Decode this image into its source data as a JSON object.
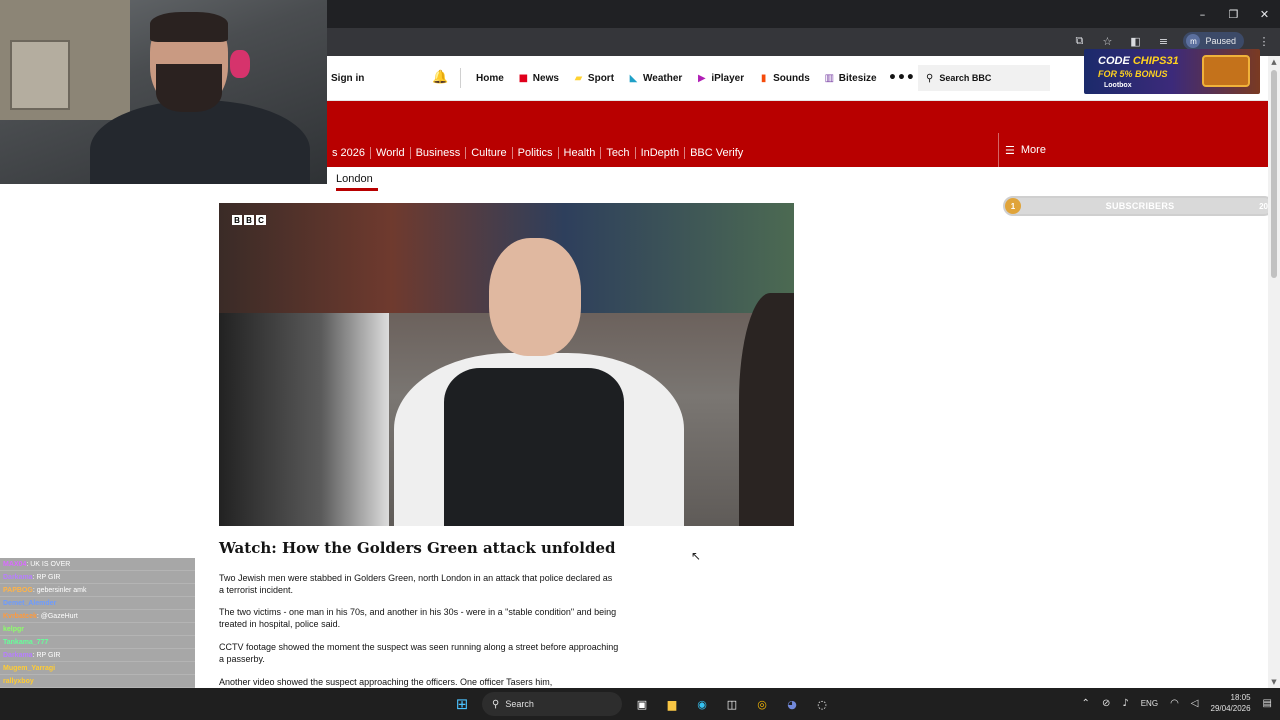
{
  "window": {
    "controls": [
      "–",
      "❐",
      "✕"
    ],
    "profile_initial": "m",
    "profile_status": "Paused"
  },
  "bbc": {
    "sign_in": "Sign in",
    "nav": [
      {
        "label": "Home",
        "icon": "",
        "color": "#141414"
      },
      {
        "label": "News",
        "icon": "news-icon",
        "color": "#e0001b"
      },
      {
        "label": "Sport",
        "icon": "sport-icon",
        "color": "#ffd230"
      },
      {
        "label": "Weather",
        "icon": "weather-icon",
        "color": "#1fa0c7"
      },
      {
        "label": "iPlayer",
        "icon": "iplayer-icon",
        "color": "#b01eb5"
      },
      {
        "label": "Sounds",
        "icon": "sounds-icon",
        "color": "#f54b0b"
      },
      {
        "label": "Bitesize",
        "icon": "bitesize-icon",
        "color": "#7941a5"
      }
    ],
    "search_placeholder": "Search BBC",
    "section_nav": [
      "s 2026",
      "World",
      "Business",
      "Culture",
      "Politics",
      "Health",
      "Tech",
      "InDepth",
      "BBC Verify"
    ],
    "more_label": "More",
    "subnav_active": "London",
    "brand_color": "#b80000"
  },
  "ad": {
    "line1_prefix": "CODE ",
    "line1_code": "CHIPS31",
    "line2": "FOR 5% BONUS",
    "brand": "Lootbox"
  },
  "hero": {
    "logo_letters": [
      "B",
      "B",
      "C"
    ]
  },
  "article": {
    "headline": "Watch: How the Golders Green attack unfolded",
    "paragraphs": [
      "Two Jewish men were stabbed in Golders Green, north London in an attack that police declared as a terrorist incident.",
      "The two victims - one man in his 70s, and another in his 30s - were in a \"stable condition\" and being treated in hospital, police said.",
      "CCTV footage showed the moment the suspect was seen running along a street before approaching a passerby.",
      "Another video showed the suspect approaching the officers. One officer Tasers him,"
    ]
  },
  "subscribers": {
    "current": "1",
    "label": "SUBSCRIBERS",
    "goal": "20",
    "progress": 0.05
  },
  "chat": [
    {
      "user": "MAX04",
      "msg": ": UK IS OVER",
      "color": "#d86bff"
    },
    {
      "user": "Darkama",
      "msg": ": RP GIR",
      "color": "#b77dff"
    },
    {
      "user": "PAPBOG",
      "msg": ": gebersinler amk",
      "color": "#ffb347"
    },
    {
      "user": "Demet_Alemder",
      "msg": "",
      "color": "#6c9bff"
    },
    {
      "user": "Kvrbatcek",
      "msg": ": @GazeHurt",
      "color": "#ff9a3c"
    },
    {
      "user": "kelpgr",
      "msg": "",
      "color": "#8cff6a"
    },
    {
      "user": "Tankama_777",
      "msg": "",
      "color": "#66ff99"
    },
    {
      "user": "Darkama",
      "msg": ": RP GIR",
      "color": "#b77dff"
    },
    {
      "user": "Mugem_Yarragi",
      "msg": "",
      "color": "#ffcc33"
    },
    {
      "user": "rallyxboy",
      "msg": "",
      "color": "#ffcc33"
    },
    {
      "user": "mafi61h",
      "msg": "",
      "color": "#ff5a5a"
    }
  ],
  "taskbar": {
    "search_label": "Search",
    "language": "ENG",
    "time": "18:05",
    "date": "29/04/2026"
  }
}
